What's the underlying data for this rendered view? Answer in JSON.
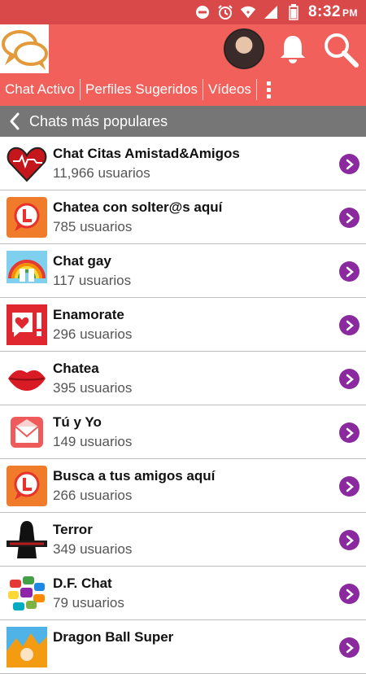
{
  "status_bar": {
    "time": "8:32",
    "ampm": "PM",
    "icons": [
      "dnd-icon",
      "alarm-icon",
      "wifi-icon",
      "signal-icon",
      "battery-icon"
    ]
  },
  "header": {
    "logo": "chat-bubbles-logo",
    "icons": [
      "avatar",
      "bell-icon",
      "search-icon"
    ]
  },
  "tabs": [
    "Chat Activo",
    "Perfiles Sugeridos",
    "Vídeos"
  ],
  "section": {
    "title": "Chats más populares"
  },
  "chats": [
    {
      "name": "Chat Citas Amistad&Amigos",
      "users": "11,966 usuarios",
      "icon": "heart-icon"
    },
    {
      "name": "Chatea con solter@s aquí",
      "users": "785 usuarios",
      "icon": "chat-l-icon"
    },
    {
      "name": "Chat gay",
      "users": "117 usuarios",
      "icon": "rainbow-icon"
    },
    {
      "name": "Enamorate",
      "users": "296 usuarios",
      "icon": "love-bubble-icon"
    },
    {
      "name": "Chatea",
      "users": "395 usuarios",
      "icon": "lips-icon"
    },
    {
      "name": "Tú y Yo",
      "users": "149 usuarios",
      "icon": "envelope-icon"
    },
    {
      "name": "Busca a tus amigos aquí",
      "users": "266 usuarios",
      "icon": "chat-l-icon"
    },
    {
      "name": "Terror",
      "users": "349 usuarios",
      "icon": "horror-figure-icon"
    },
    {
      "name": "D.F. Chat",
      "users": "79 usuarios",
      "icon": "colorful-bubbles-icon"
    },
    {
      "name": "Dragon Ball Super",
      "users": "",
      "icon": "anime-icon"
    }
  ],
  "colors": {
    "status_bar": "#d9494a",
    "header": "#f1605b",
    "section_bar": "#767676",
    "chevron": "#8a2a9e"
  }
}
